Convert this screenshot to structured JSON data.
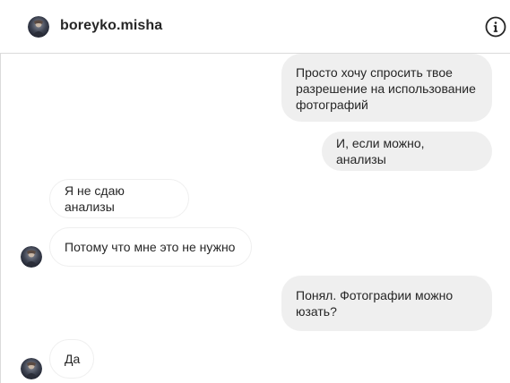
{
  "header": {
    "username": "boreyko.misha",
    "avatar_icon": "user-avatar-photo",
    "info_icon": "info-circle-icon"
  },
  "messages": [
    {
      "direction": "outgoing",
      "text": "Просто хочу спросить твое разрешение на использование фотографий"
    },
    {
      "direction": "outgoing",
      "text": "И, если можно, анализы"
    },
    {
      "direction": "incoming",
      "text": "Я не сдаю анализы"
    },
    {
      "direction": "incoming",
      "text": "Потому что мне это не нужно"
    },
    {
      "direction": "outgoing",
      "text": "Понял. Фотографии можно юзать?"
    },
    {
      "direction": "incoming",
      "text": "Да"
    }
  ],
  "colors": {
    "outgoing_bubble": "#efefef",
    "incoming_border": "#efefef",
    "divider": "#dbdbdb",
    "text": "#262626"
  }
}
